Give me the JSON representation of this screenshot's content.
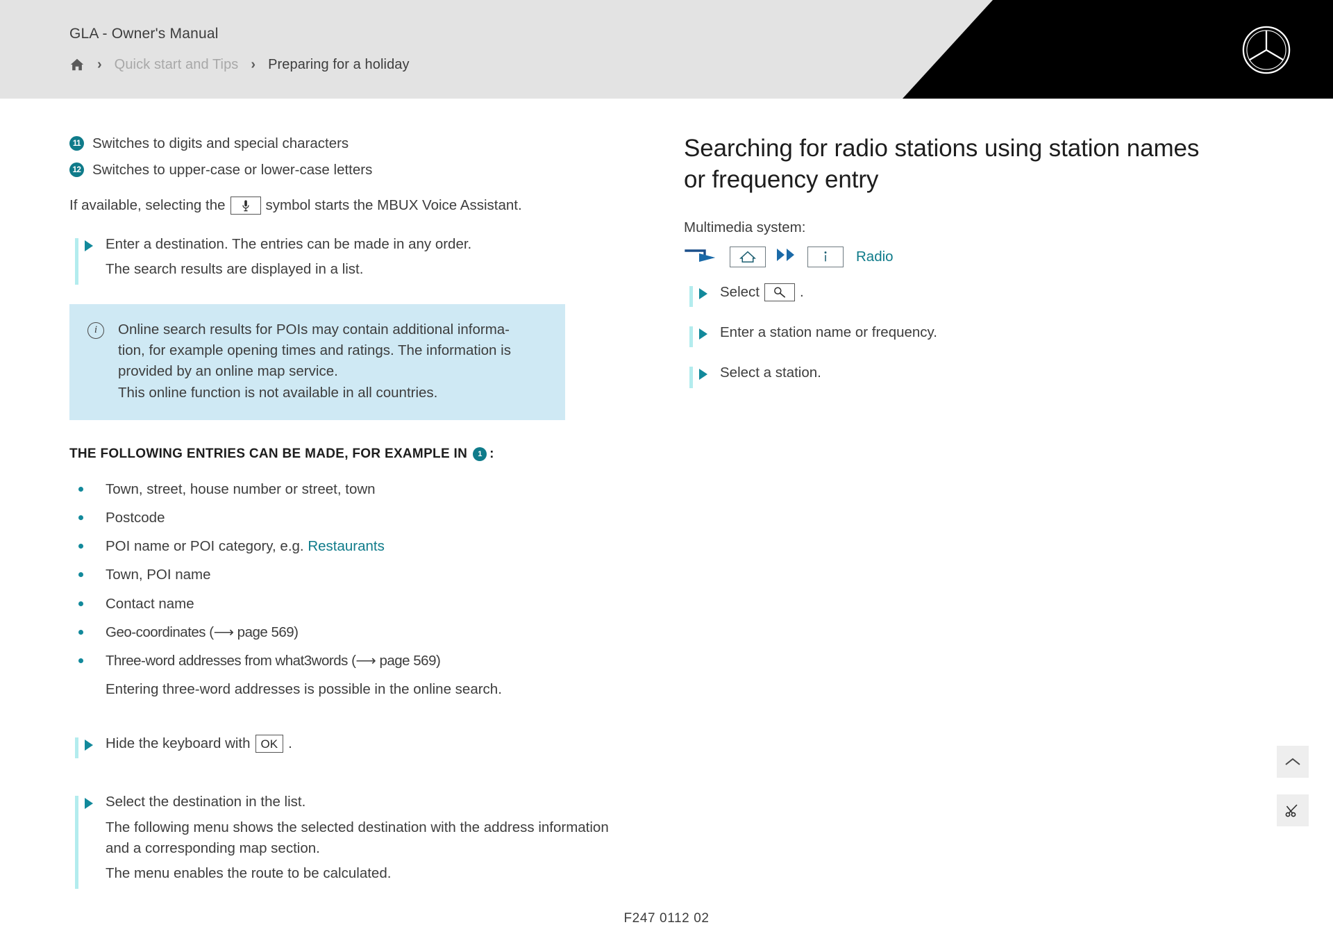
{
  "header": {
    "manual_title": "GLA - Owner's Manual",
    "breadcrumb": {
      "home_icon": "home-icon",
      "separator": "›",
      "items": [
        {
          "label": "Quick start and Tips",
          "muted": true
        },
        {
          "label": "Preparing for a holiday",
          "muted": false
        }
      ]
    },
    "brand_logo": "mercedes-benz-star-icon",
    "bg_color": "#e3e3e3",
    "panel_color": "#000000"
  },
  "left_column": {
    "callouts": [
      {
        "number": "11",
        "text": "Switches to digits and special characters"
      },
      {
        "number": "12",
        "text": "Switches to upper-case or lower-case letters"
      }
    ],
    "voice_paragraph": {
      "before": "If available, selecting the",
      "symbol": "microphone-icon",
      "after": "symbol starts the MBUX Voice Assistant."
    },
    "steps_top": [
      "Enter a destination. The entries can be made in any order.",
      "The search results are displayed in a list."
    ],
    "info_box": {
      "icon": "info-icon",
      "lines": [
        "Online search results for POIs may contain additional informa-",
        "tion, for example opening times and ratings. The information is",
        "provided by an online map service.",
        "This online function is not available in all countries."
      ],
      "bg_color": "#cfe9f4"
    },
    "entries_heading": {
      "before": "THE FOLLOWING ENTRIES CAN BE MADE, FOR EXAMPLE IN",
      "badge": "1",
      "after": ":"
    },
    "entries": [
      {
        "text": "Town, street, house number or street, town"
      },
      {
        "text": "Postcode"
      },
      {
        "text": "POI name or POI category, e.g. ",
        "link": "Restaurants"
      },
      {
        "text": "Town, POI name"
      },
      {
        "text": "Contact name"
      },
      {
        "text": "Geo-coordinates (⟶ page 569)"
      },
      {
        "text": "Three-word addresses from what3words (⟶ page 569)"
      }
    ],
    "entries_note": "Entering three-word addresses is possible in the online search.",
    "step_keyboard": {
      "before": "Hide the keyboard with",
      "key": "OK",
      "after": "."
    },
    "steps_bottom": [
      "Select the destination in the list.",
      "The following menu shows the selected destination with the address information and a corresponding map section.",
      "The menu enables the route to be calculated."
    ]
  },
  "right_column": {
    "title": "Searching for radio stations using station names or frequency entry",
    "multimedia_label": "Multimedia system:",
    "icon_path": [
      {
        "type": "turn-arrow",
        "name": "turn-arrow-icon"
      },
      {
        "type": "box",
        "name": "home-icon"
      },
      {
        "type": "double-chevron",
        "name": "double-chevron-icon"
      },
      {
        "type": "box",
        "name": "info-icon"
      },
      {
        "type": "text",
        "name": "radio-label",
        "label": "Radio"
      }
    ],
    "steps": [
      {
        "before": "Select",
        "key": "search-icon",
        "after": "."
      },
      {
        "before": "Enter a station name or frequency.",
        "key": null,
        "after": ""
      },
      {
        "before": "Select a station.",
        "key": null,
        "after": ""
      }
    ]
  },
  "side_buttons": [
    {
      "name": "scroll-to-top-button",
      "icon": "chevron-up-icon"
    },
    {
      "name": "scissors-button",
      "icon": "scissors-icon"
    }
  ],
  "footer": {
    "document_code": "F247 0112 02"
  },
  "colors": {
    "teal": "#0f7b8a",
    "teal_bright": "#12899b",
    "teal_bar": "#b3ecee",
    "info_blue": "#cfe9f4",
    "text": "#3d3d3d",
    "dark_blue": "#1b4f8a"
  }
}
